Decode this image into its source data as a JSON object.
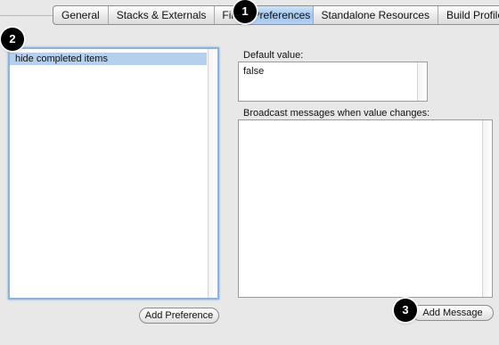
{
  "tabs": [
    {
      "label": "General",
      "selected": false
    },
    {
      "label": "Stacks & Externals",
      "selected": false
    },
    {
      "label": "Files",
      "selected": false
    },
    {
      "label": "Preferences",
      "selected": true
    },
    {
      "label": "Standalone Resources",
      "selected": false
    },
    {
      "label": "Build Profiles",
      "selected": false
    }
  ],
  "preferences": {
    "items": [
      "hide completed items"
    ],
    "selected_index": 0,
    "add_button_label": "Add Preference"
  },
  "default_value": {
    "label": "Default value:",
    "value": "false"
  },
  "broadcast": {
    "label": "Broadcast messages when value changes:",
    "value": "",
    "add_button_label": "Add Message"
  },
  "markers": [
    "1",
    "2",
    "3"
  ],
  "colors": {
    "selection": "#b5d0ee",
    "selected_tab": "#9fc4ee",
    "marker_bg": "#000000"
  }
}
